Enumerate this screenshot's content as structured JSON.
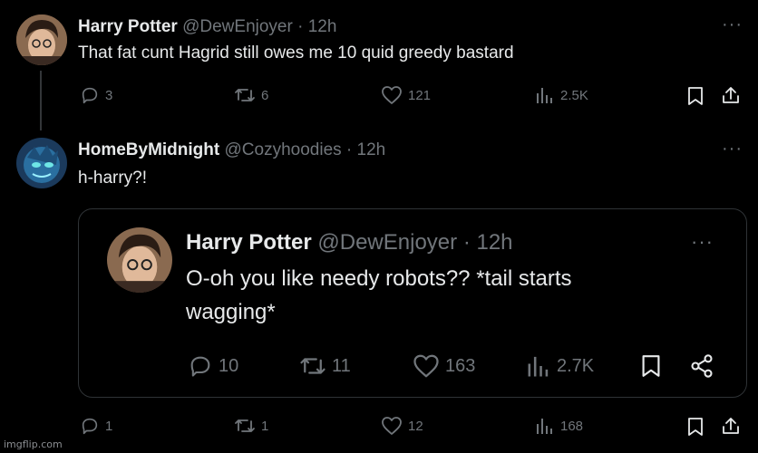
{
  "tweet1": {
    "name": "Harry Potter",
    "handle": "@DewEnjoyer",
    "time": "· 12h",
    "text": "That fat cunt Hagrid still owes me 10 quid greedy bastard",
    "more": "···",
    "replies": "3",
    "reposts": "6",
    "likes": "121",
    "views": "2.5K"
  },
  "tweet2": {
    "name": "HomeByMidnight",
    "handle": "@Cozyhoodies",
    "time": "· 12h",
    "text": "h-harry?!",
    "more": "···",
    "replies": "1",
    "reposts": "1",
    "likes": "12",
    "views": "168"
  },
  "quote": {
    "name": "Harry Potter",
    "handle": "@DewEnjoyer",
    "time": "· 12h",
    "text_line1": "O-oh you like needy robots?? *tail starts",
    "text_line2": "wagging*",
    "more": "···",
    "replies": "10",
    "reposts": "11",
    "likes": "163",
    "views": "2.7K"
  },
  "watermark": "imgflip.com",
  "colors": {
    "background": "#000000",
    "text": "#e7e9ea",
    "muted": "#71767b",
    "border": "#2f3336"
  }
}
